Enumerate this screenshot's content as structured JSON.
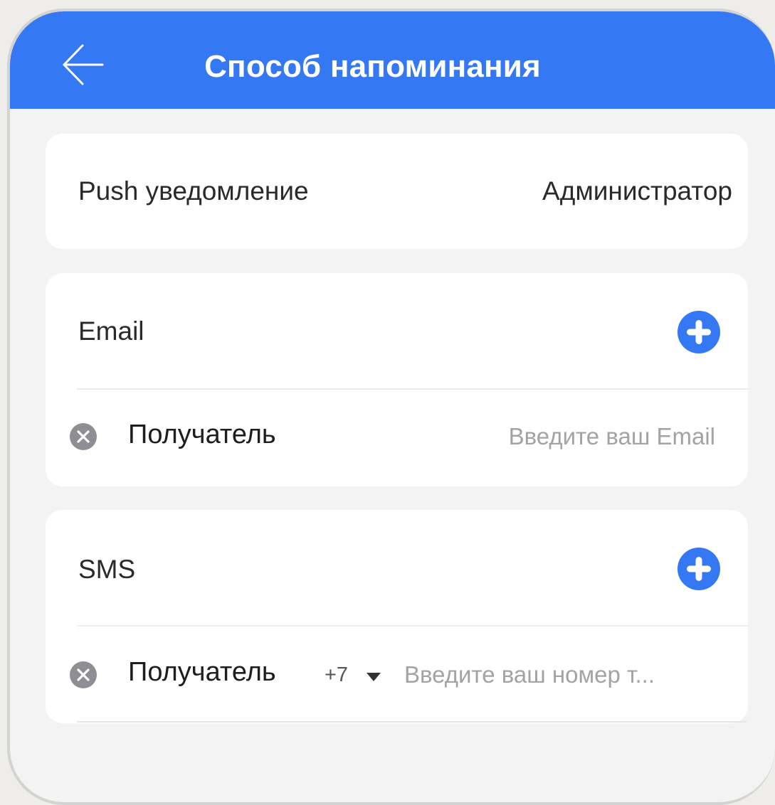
{
  "header": {
    "title": "Способ напоминания",
    "back_icon": "back-arrow-icon",
    "background_color": "#3578f4"
  },
  "push": {
    "label": "Push уведомление",
    "value": "Администратор"
  },
  "email": {
    "label": "Email",
    "add_icon": "plus-circle-icon",
    "recipient_label": "Получатель",
    "remove_icon": "remove-circle-icon",
    "input_value": "",
    "input_placeholder": "Введите ваш Email"
  },
  "sms": {
    "label": "SMS",
    "add_icon": "plus-circle-icon",
    "recipient_label": "Получатель",
    "remove_icon": "remove-circle-icon",
    "country_code": "+7",
    "input_value": "",
    "input_placeholder": "Введите ваш номер т..."
  },
  "colors": {
    "accent": "#3578f4",
    "remove_gray": "#8e8e93"
  }
}
